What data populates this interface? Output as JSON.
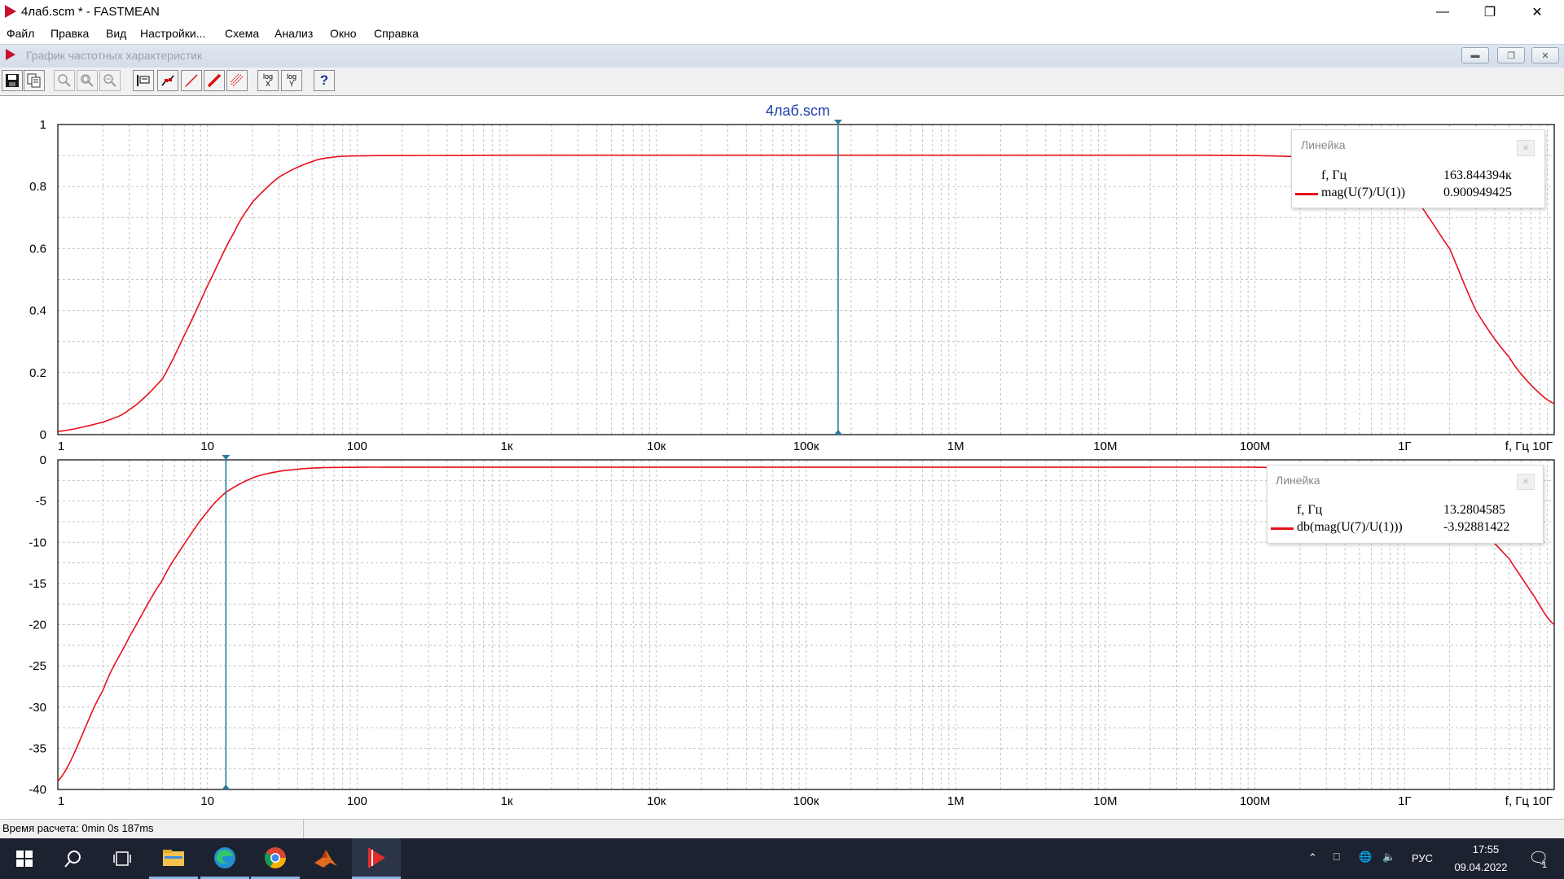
{
  "window": {
    "title": "4лаб.scm * - FASTMEAN",
    "controls": [
      "minimize-icon",
      "restore-icon",
      "close-icon"
    ]
  },
  "menu": [
    "Файл",
    "Правка",
    "Вид",
    "Настройки...",
    "Схема",
    "Анализ",
    "Окно",
    "Справка"
  ],
  "child_window": {
    "title": "График частотных характеристик"
  },
  "toolbar": {
    "buttons": [
      "save-icon",
      "copy-icon",
      "zoom-in-icon",
      "zoom-window-icon",
      "zoom-out-icon",
      "ruler-icon",
      "markers-icon",
      "line-icon",
      "thick-line-icon",
      "grid-icon",
      "log-x-icon",
      "log-y-icon",
      "help-icon"
    ],
    "log_label": "log",
    "x_label": "X",
    "y_label": "Y",
    "help_label": "?"
  },
  "plot": {
    "title": "4лаб.scm",
    "trace_color": "#e8101a",
    "cursor_color": "#2a7a9a"
  },
  "chart_data": [
    {
      "type": "line",
      "xscale": "log",
      "xlim": [
        1,
        10000000000
      ],
      "ylim": [
        0,
        1
      ],
      "x_ticks": [
        "1",
        "10",
        "100",
        "1к",
        "10к",
        "100к",
        "1М",
        "10М",
        "100М",
        "1Г"
      ],
      "x_axis_end_label": "f, Гц 10Г",
      "y_ticks": [
        "0",
        "0.2",
        "0.4",
        "0.6",
        "0.8",
        "1"
      ],
      "grid": true,
      "series": [
        {
          "name": "mag(U(7)/U(1))",
          "x": [
            1,
            2,
            3,
            5,
            7,
            10,
            15,
            20,
            30,
            50,
            70,
            100,
            200,
            1000,
            100000,
            10000000,
            100000000,
            300000000,
            600000000,
            1000000000,
            2000000000,
            3000000000,
            5000000000,
            7000000000,
            10000000000
          ],
          "y": [
            0.01,
            0.04,
            0.08,
            0.18,
            0.32,
            0.48,
            0.65,
            0.75,
            0.83,
            0.88,
            0.895,
            0.899,
            0.9,
            0.901,
            0.901,
            0.901,
            0.9,
            0.89,
            0.86,
            0.8,
            0.6,
            0.4,
            0.25,
            0.16,
            0.1
          ]
        }
      ],
      "cursor": {
        "x": 163844.394
      },
      "ruler": {
        "title": "Линейка",
        "x_label": "f, Гц",
        "x_value": "163.844394к",
        "series_label": "mag(U(7)/U(1))",
        "series_value": "0.900949425"
      }
    },
    {
      "type": "line",
      "xscale": "log",
      "xlim": [
        1,
        10000000000
      ],
      "ylim": [
        -40,
        0
      ],
      "x_ticks": [
        "1",
        "10",
        "100",
        "1к",
        "10к",
        "100к",
        "1М",
        "10М",
        "100М",
        "1Г"
      ],
      "x_axis_end_label": "f, Гц 10Г",
      "y_ticks": [
        "0",
        "-5",
        "-10",
        "-15",
        "-20",
        "-25",
        "-30",
        "-35",
        "-40"
      ],
      "grid": true,
      "series": [
        {
          "name": "db(mag(U(7)/U(1)))",
          "x": [
            1,
            2,
            3,
            5,
            7,
            10,
            13.28,
            20,
            30,
            50,
            100,
            200,
            1000,
            100000,
            10000000,
            100000000,
            300000000,
            600000000,
            1000000000,
            2000000000,
            3000000000,
            5000000000,
            7000000000,
            10000000000
          ],
          "y": [
            -39,
            -28,
            -21.5,
            -14.6,
            -10.2,
            -6.3,
            -3.93,
            -2.2,
            -1.4,
            -1.0,
            -0.9,
            -0.9,
            -0.9,
            -0.9,
            -0.9,
            -0.9,
            -1.1,
            -1.4,
            -1.9,
            -4.5,
            -7.8,
            -12,
            -16,
            -20
          ]
        }
      ],
      "cursor": {
        "x": 13.2804585
      },
      "ruler": {
        "title": "Линейка",
        "x_label": "f, Гц",
        "x_value": "13.2804585",
        "series_label": "db(mag(U(7)/U(1)))",
        "series_value": "-3.92881422"
      }
    }
  ],
  "status": {
    "text": "Время расчета: 0min 0s 187ms"
  },
  "taskbar": {
    "apps": [
      "windows-start-icon",
      "search-icon",
      "task-view-icon",
      "file-explorer-icon",
      "edge-icon",
      "chrome-icon",
      "matlab-icon",
      "fastmean-icon"
    ],
    "language": "РУС",
    "time": "17:55",
    "date": "09.04.2022",
    "notification_count": "1"
  }
}
